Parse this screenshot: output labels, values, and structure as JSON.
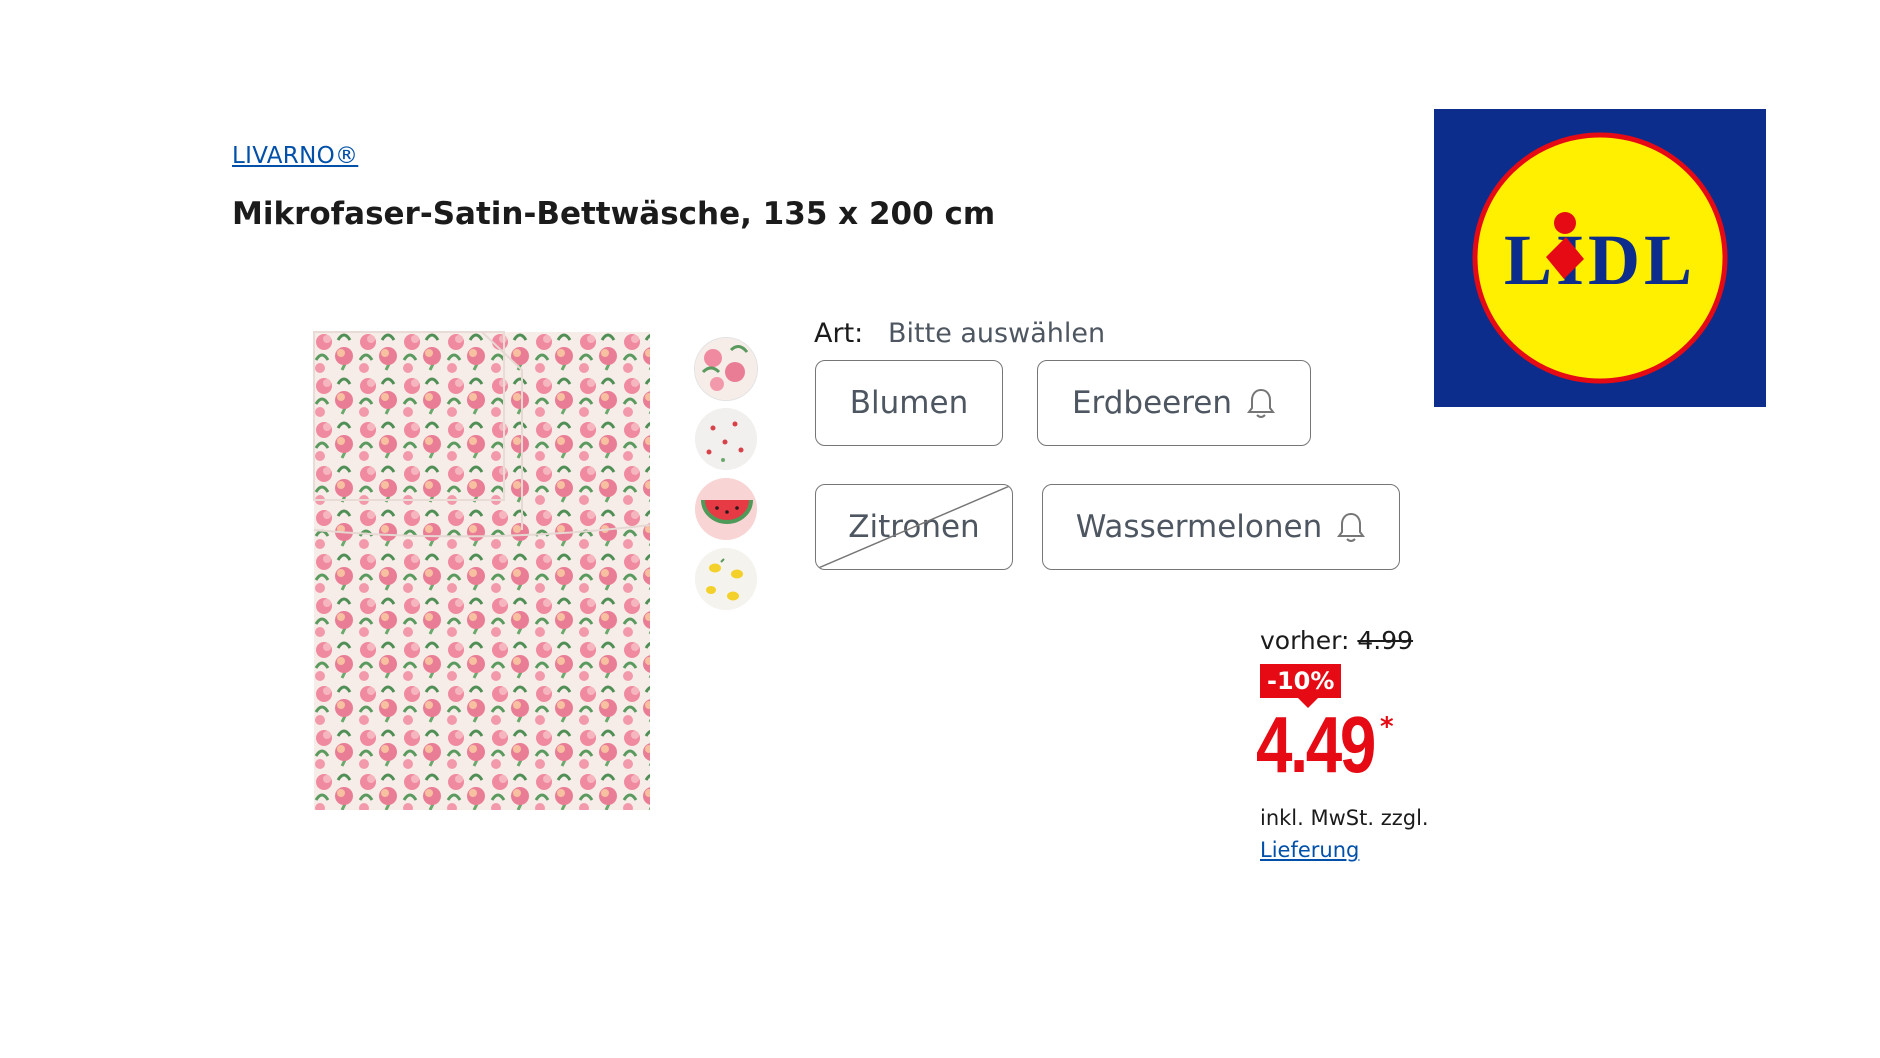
{
  "product": {
    "brand": "LIVARNO®",
    "title": "Mikrofaser-Satin-Bettwäsche, 135 x 200 cm"
  },
  "gallery": {
    "thumbnails": [
      "Blumen",
      "Erdbeeren",
      "Wassermelonen",
      "Zitronen"
    ]
  },
  "variant": {
    "label": "Art:",
    "value": "Bitte auswählen",
    "options": [
      {
        "label": "Blumen",
        "status": "available"
      },
      {
        "label": "Erdbeeren",
        "status": "notify"
      },
      {
        "label": "Zitronen",
        "status": "unavailable"
      },
      {
        "label": "Wassermelonen",
        "status": "notify"
      }
    ]
  },
  "price": {
    "old_label": "vorher:",
    "old_value": "4.99",
    "discount": "-10%",
    "current": "4.49",
    "asterisk": "*",
    "tax_note": "inkl. MwSt. zzgl.",
    "delivery_link": "Lieferung"
  },
  "logo": {
    "text": "LIDL",
    "colors": {
      "background": "#0c2d8c",
      "circle": "#fff000",
      "text": "#0c2d8c",
      "accent": "#e60a14"
    }
  },
  "colors": {
    "link": "#0050aa",
    "price_red": "#e60a14",
    "chip_text": "#4e5761"
  }
}
